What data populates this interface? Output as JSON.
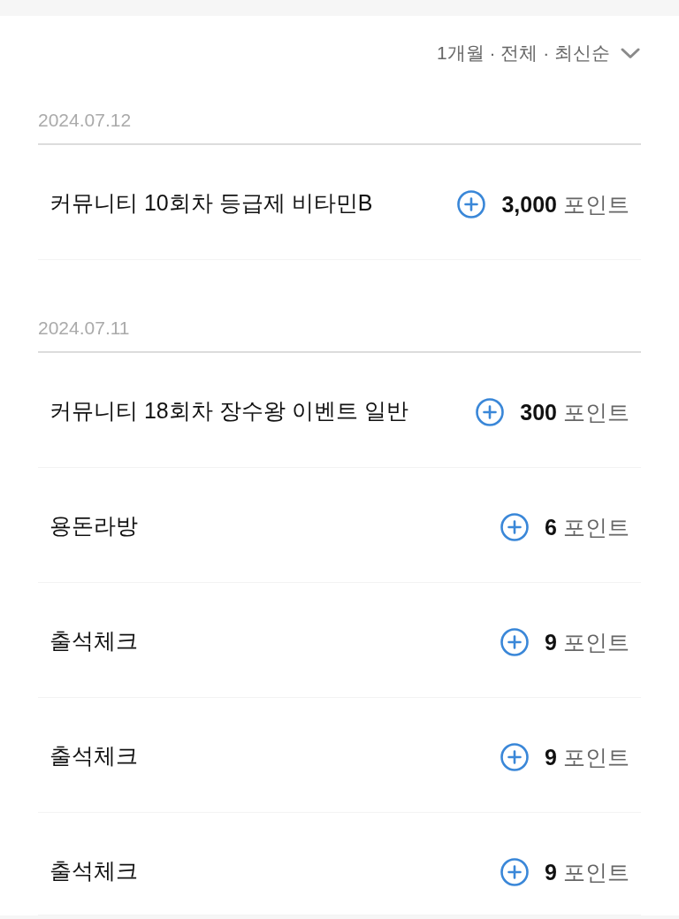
{
  "filter": {
    "label": "1개월 · 전체 · 최신순"
  },
  "groups": [
    {
      "date": "2024.07.12",
      "items": [
        {
          "title": "커뮤니티 10회차 등급제 비타민B",
          "amount": "3,000",
          "unit": "포인트"
        }
      ]
    },
    {
      "date": "2024.07.11",
      "items": [
        {
          "title": "커뮤니티 18회차 장수왕 이벤트 일반",
          "amount": "300",
          "unit": "포인트"
        },
        {
          "title": "용돈라방",
          "amount": "6",
          "unit": "포인트"
        },
        {
          "title": "출석체크",
          "amount": "9",
          "unit": "포인트"
        },
        {
          "title": "출석체크",
          "amount": "9",
          "unit": "포인트"
        },
        {
          "title": "출석체크",
          "amount": "9",
          "unit": "포인트"
        }
      ]
    }
  ]
}
